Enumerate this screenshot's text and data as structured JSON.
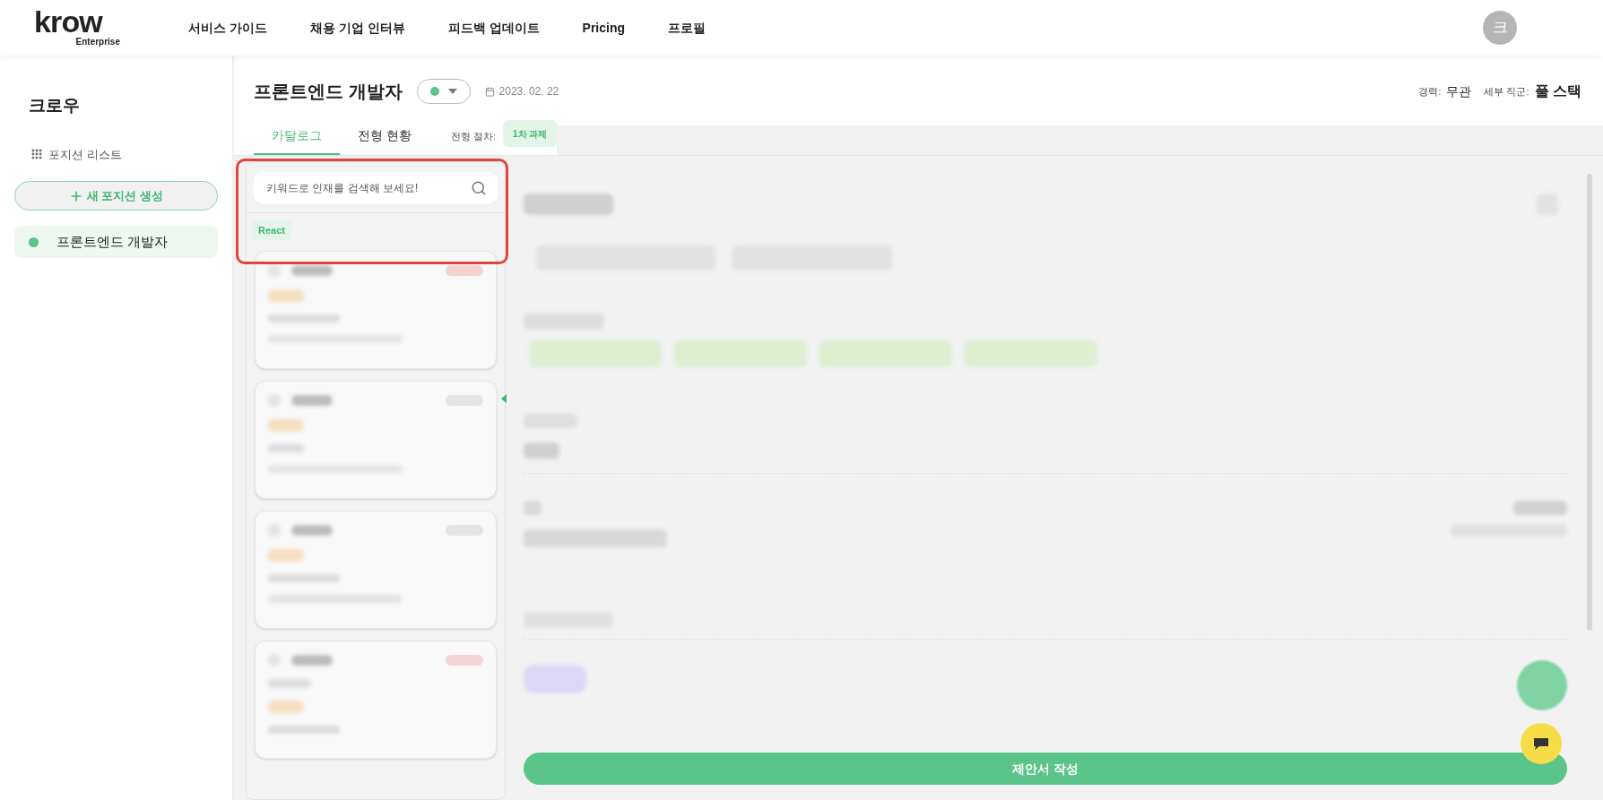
{
  "header": {
    "logo": "krow",
    "logo_sub": "Enterprise",
    "nav": [
      "서비스 가이드",
      "채용 기업 인터뷰",
      "피드백 업데이트",
      "Pricing",
      "프로필"
    ],
    "avatar": "크"
  },
  "sidebar": {
    "title": "크로우",
    "list_link": "포지션 리스트",
    "new_button": "새 포지션 생성",
    "positions": [
      {
        "label": "프론트엔드 개발자",
        "selected": true,
        "color": "#5bc489"
      }
    ]
  },
  "position": {
    "title": "프론트엔드 개발자",
    "status": {
      "color": "#5bc489"
    },
    "date": "2023. 02. 22",
    "experience_label": "경력:",
    "experience": "무관",
    "role_label": "세부 직군:",
    "role": "풀 스택"
  },
  "tabs": [
    {
      "label": "카탈로그",
      "selected": true
    },
    {
      "label": "전형 현황",
      "selected": false
    }
  ],
  "stage": {
    "label": "전형 절차:",
    "badge": "1차 과제"
  },
  "search": {
    "placeholder": "키워드로 인재를 검색해 보세요!",
    "tags": [
      "React"
    ]
  },
  "candidate_cards": [
    {
      "color": "#f3d4d2"
    },
    {
      "color": "#e4e4e4"
    },
    {
      "color": "#e4e4e4"
    },
    {
      "color": "#f3d4d2"
    }
  ],
  "submit_button": "제안서 작성"
}
